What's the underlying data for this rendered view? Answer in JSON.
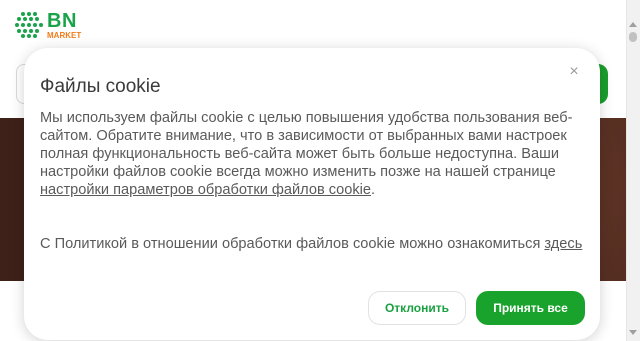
{
  "brand": {
    "name": "BN",
    "sub": "MARKET",
    "green": "#1aa34a",
    "orange": "#f07c1b"
  },
  "cookie_modal": {
    "title": "Файлы cookie",
    "close_icon": "close-icon",
    "text_1": "Мы используем файлы cookie с целью повышения удобства пользования веб-сайтом. Обратите внимание, что в зависимости от выбранных вами настроек полная функциональность веб-сайта может быть больше недоступна. Ваши настройки файлов cookie всегда можно изменить позже на нашей странице ",
    "settings_link": "настройки параметров обработки файлов cookie",
    "text_1_end": ".",
    "text_2": "С Политикой в отношении обработки файлов cookie можно ознакомиться ",
    "policy_link": "здесь",
    "decline_label": "Отклонить",
    "accept_label": "Принять все",
    "accent_color": "#1aa32c"
  }
}
